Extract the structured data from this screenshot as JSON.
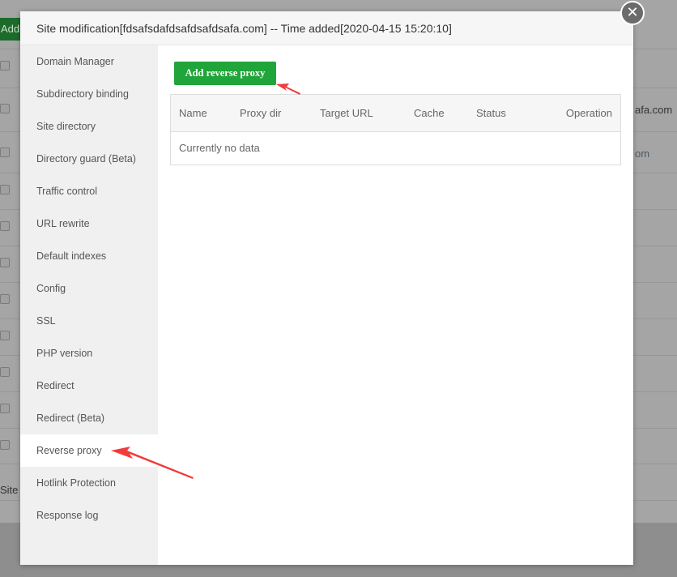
{
  "background": {
    "add_label": "Add",
    "site_label": "Site",
    "row_text_1": "afa.com",
    "row_text_2": "om"
  },
  "modal": {
    "title": "Site modification[fdsafsdafdsafdsafdsafa.com] -- Time added[2020-04-15 15:20:10]",
    "close_icon": "close-icon",
    "sidebar": [
      {
        "label": "Domain Manager"
      },
      {
        "label": "Subdirectory binding"
      },
      {
        "label": "Site directory"
      },
      {
        "label": "Directory guard (Beta)"
      },
      {
        "label": "Traffic control"
      },
      {
        "label": "URL rewrite"
      },
      {
        "label": "Default indexes"
      },
      {
        "label": "Config"
      },
      {
        "label": "SSL"
      },
      {
        "label": "PHP version"
      },
      {
        "label": "Redirect"
      },
      {
        "label": "Redirect (Beta)"
      },
      {
        "label": "Reverse proxy",
        "active": true
      },
      {
        "label": "Hotlink Protection"
      },
      {
        "label": "Response log"
      }
    ],
    "add_button": "Add reverse proxy",
    "table": {
      "columns": [
        "Name",
        "Proxy dir",
        "Target URL",
        "Cache",
        "Status",
        "Operation"
      ],
      "empty_text": "Currently no data"
    }
  },
  "colors": {
    "accent": "#20a53a",
    "annotation": "#f03c3c"
  }
}
